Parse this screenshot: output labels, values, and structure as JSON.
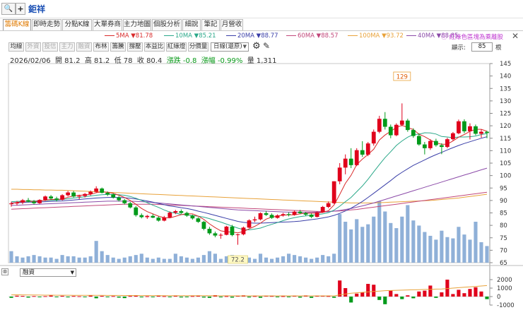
{
  "header": {
    "search_icon": "🔍",
    "add_icon": "+",
    "stock_name": "鉅祥"
  },
  "tabs": [
    {
      "label": "籌碼K線",
      "active": true
    },
    {
      "label": "即時走勢"
    },
    {
      "label": "分點K線"
    },
    {
      "label": "大單券商"
    },
    {
      "label": "主力地圖"
    },
    {
      "label": "個股分析"
    },
    {
      "label": "細說"
    },
    {
      "label": "筆記"
    },
    {
      "label": "月營收"
    }
  ],
  "ma_legend": [
    {
      "label": "5MA ▼81.78",
      "color": "#d92a2a"
    },
    {
      "label": "10MA ▼85.21",
      "color": "#2aa889"
    },
    {
      "label": "20MA ▼88.77",
      "color": "#3a3fa8"
    },
    {
      "label": "60MA ▼88.57",
      "color": "#c2477a"
    },
    {
      "label": "100MA ▼93.72",
      "color": "#e8a23a"
    },
    {
      "label": "40MA ▼88.85",
      "color": "#8b4aa8"
    }
  ],
  "ma_note": "ⓘ 紅綠色區塊為乘離股",
  "toolbar": {
    "buttons": [
      {
        "label": "均線",
        "dim": false
      },
      {
        "label": "外資",
        "dim": true
      },
      {
        "label": "投信",
        "dim": true
      },
      {
        "label": "主力",
        "dim": true
      },
      {
        "label": "融資",
        "dim": true
      },
      {
        "label": "布林",
        "dim": false
      },
      {
        "label": "籌騰",
        "dim": false
      },
      {
        "label": "撐壓",
        "dim": false
      },
      {
        "label": "本益比",
        "dim": false
      },
      {
        "label": "紅綠燈",
        "dim": false
      },
      {
        "label": "分價量",
        "dim": false
      }
    ],
    "period_select": "日線(還原)",
    "zoom_label": "顯示:",
    "zoom_value": "85",
    "zoom_unit": "根"
  },
  "quote": {
    "date": "2026/02/06",
    "open": "開 81.2",
    "high": "高 81.2",
    "low": "低 78",
    "close": "收 80.4",
    "change": "漲跌 -0.8",
    "change_pct": "漲幅 -0.99%",
    "volume": "量 1,311"
  },
  "sub_panel": {
    "close_icon": "⊗",
    "indicator_select": "融資"
  },
  "colors": {
    "up": "#e0001b",
    "down": "#009a1a",
    "volume": "#8fb0d8"
  },
  "chart_data": {
    "type": "candlestick",
    "price_axis": {
      "min": 65,
      "max": 145,
      "ticks": [
        65,
        70,
        75,
        80,
        85,
        90,
        95,
        100,
        105,
        110,
        115,
        120,
        125,
        130,
        135,
        140,
        145
      ]
    },
    "annotations": [
      {
        "label": "129",
        "value": 129
      },
      {
        "label": "72.2",
        "value": 72.2
      }
    ],
    "candles": [
      [
        88.5,
        89.5,
        87.5,
        88.8
      ],
      [
        88.8,
        89.8,
        88.0,
        89.2
      ],
      [
        89.2,
        90.6,
        88.5,
        90.1
      ],
      [
        90.1,
        91.0,
        89.2,
        89.5
      ],
      [
        89.5,
        90.2,
        88.4,
        88.9
      ],
      [
        88.9,
        90.5,
        88.6,
        90.2
      ],
      [
        90.2,
        92.0,
        89.8,
        91.6
      ],
      [
        91.6,
        92.2,
        90.4,
        90.8
      ],
      [
        90.8,
        91.5,
        89.6,
        90.3
      ],
      [
        90.3,
        92.5,
        90.0,
        92.1
      ],
      [
        92.1,
        93.8,
        91.6,
        93.2
      ],
      [
        93.2,
        93.8,
        91.2,
        91.6
      ],
      [
        91.6,
        92.3,
        90.5,
        91.8
      ],
      [
        91.8,
        93.0,
        91.2,
        92.6
      ],
      [
        92.6,
        94.0,
        92.0,
        93.5
      ],
      [
        93.5,
        95.7,
        93.0,
        94.8
      ],
      [
        94.8,
        95.2,
        92.8,
        93.1
      ],
      [
        93.1,
        93.6,
        91.8,
        92.4
      ],
      [
        92.4,
        92.9,
        90.8,
        91.2
      ],
      [
        91.2,
        91.8,
        89.6,
        90.1
      ],
      [
        90.1,
        90.6,
        88.4,
        88.9
      ],
      [
        88.9,
        89.4,
        86.8,
        87.2
      ],
      [
        87.2,
        87.8,
        83.5,
        84.1
      ],
      [
        84.1,
        84.8,
        82.8,
        83.3
      ],
      [
        83.3,
        84.2,
        82.6,
        83.8
      ],
      [
        83.8,
        84.5,
        82.9,
        83.1
      ],
      [
        83.1,
        83.6,
        81.5,
        81.9
      ],
      [
        81.9,
        83.8,
        81.6,
        83.2
      ],
      [
        83.2,
        85.6,
        82.9,
        85.1
      ],
      [
        85.1,
        86.2,
        84.5,
        85.7
      ],
      [
        85.7,
        86.4,
        84.6,
        85.0
      ],
      [
        85.0,
        85.5,
        83.4,
        83.9
      ],
      [
        83.9,
        84.3,
        82.3,
        82.8
      ],
      [
        82.8,
        83.3,
        81.0,
        81.4
      ],
      [
        81.4,
        81.8,
        78.0,
        78.6
      ],
      [
        78.6,
        79.4,
        76.2,
        76.8
      ],
      [
        76.8,
        77.5,
        75.2,
        75.9
      ],
      [
        75.9,
        76.8,
        74.6,
        76.2
      ],
      [
        76.2,
        79.8,
        76.0,
        79.5
      ],
      [
        79.5,
        80.2,
        75.6,
        76.1
      ],
      [
        76.1,
        76.6,
        72.2,
        76.4
      ],
      [
        76.4,
        79.5,
        76.0,
        79.1
      ],
      [
        79.1,
        82.4,
        78.9,
        82.0
      ],
      [
        82.0,
        83.5,
        81.3,
        82.4
      ],
      [
        82.4,
        85.2,
        82.0,
        84.9
      ],
      [
        84.9,
        85.8,
        83.8,
        84.2
      ],
      [
        84.2,
        84.8,
        82.6,
        83.0
      ],
      [
        83.0,
        84.4,
        82.7,
        84.0
      ],
      [
        84.0,
        85.0,
        83.5,
        84.5
      ],
      [
        84.5,
        85.2,
        83.6,
        84.2
      ],
      [
        84.2,
        85.9,
        83.9,
        85.5
      ],
      [
        85.5,
        86.2,
        84.5,
        84.9
      ],
      [
        84.9,
        85.4,
        83.8,
        84.3
      ],
      [
        84.3,
        84.8,
        82.9,
        83.4
      ],
      [
        83.4,
        85.6,
        83.2,
        85.2
      ],
      [
        85.2,
        87.8,
        85.0,
        87.4
      ],
      [
        87.4,
        89.6,
        86.9,
        88.9
      ],
      [
        88.9,
        97.7,
        88.6,
        97.7
      ],
      [
        97.7,
        105.0,
        96.5,
        103.2
      ],
      [
        103.2,
        108.5,
        100.5,
        106.8
      ],
      [
        106.8,
        111.0,
        103.0,
        104.2
      ],
      [
        104.2,
        111.0,
        103.8,
        110.2
      ],
      [
        110.2,
        113.8,
        107.5,
        108.4
      ],
      [
        108.4,
        113.5,
        107.8,
        112.9
      ],
      [
        112.9,
        118.5,
        112.0,
        117.6
      ],
      [
        117.6,
        124.0,
        117.0,
        122.8
      ],
      [
        122.8,
        125.5,
        118.5,
        119.6
      ],
      [
        119.6,
        120.5,
        115.0,
        116.2
      ],
      [
        116.2,
        121.0,
        115.8,
        120.4
      ],
      [
        120.4,
        129.0,
        119.8,
        122.1
      ],
      [
        122.1,
        122.8,
        117.6,
        118.3
      ],
      [
        118.3,
        119.0,
        115.2,
        115.9
      ],
      [
        115.9,
        117.0,
        112.0,
        112.5
      ],
      [
        112.5,
        113.5,
        108.5,
        111.0
      ],
      [
        111.0,
        114.6,
        110.3,
        113.9
      ],
      [
        113.9,
        114.8,
        111.6,
        112.2
      ],
      [
        112.2,
        113.0,
        108.6,
        111.5
      ],
      [
        111.5,
        115.2,
        111.0,
        114.6
      ],
      [
        114.6,
        117.5,
        114.0,
        117.0
      ],
      [
        117.0,
        122.5,
        116.6,
        121.8
      ],
      [
        121.8,
        122.6,
        117.0,
        117.8
      ],
      [
        117.8,
        121.0,
        114.5,
        119.8
      ],
      [
        119.8,
        120.5,
        116.2,
        116.8
      ],
      [
        116.8,
        118.5,
        115.2,
        117.6
      ],
      [
        117.6,
        118.0,
        115.0,
        117.1
      ]
    ],
    "volume": [
      9,
      5,
      4,
      5,
      6,
      5,
      4,
      4,
      3,
      6,
      5,
      5,
      4,
      4,
      5,
      17,
      9,
      6,
      4,
      3,
      4,
      5,
      6,
      7,
      4,
      3,
      4,
      3,
      3,
      7,
      5,
      4,
      3,
      4,
      6,
      9,
      7,
      3,
      5,
      6,
      3,
      5,
      4,
      3,
      7,
      4,
      3,
      4,
      5,
      7,
      6,
      5,
      4,
      3,
      4,
      6,
      5,
      7,
      38,
      32,
      26,
      34,
      28,
      30,
      36,
      48,
      40,
      31,
      27,
      36,
      45,
      33,
      29,
      24,
      21,
      18,
      25,
      20,
      19,
      28,
      22,
      18,
      32,
      16,
      13
    ],
    "ma": {
      "MA5": [
        88.8,
        89.2,
        89.6,
        89.7,
        89.6,
        89.7,
        90.1,
        90.4,
        90.4,
        90.6,
        91.3,
        91.8,
        92.1,
        92.2,
        92.5,
        93.1,
        93.5,
        93.3,
        92.9,
        92.1,
        91.2,
        90.0,
        88.5,
        86.8,
        85.5,
        84.6,
        83.7,
        83.1,
        83.0,
        83.6,
        84.3,
        84.7,
        84.6,
        83.7,
        82.4,
        80.6,
        79.1,
        77.8,
        77.4,
        77.3,
        77.0,
        77.5,
        78.6,
        79.6,
        80.9,
        82.5,
        83.3,
        83.7,
        84.1,
        84.2,
        84.2,
        84.6,
        84.9,
        84.9,
        84.9,
        85.2,
        85.9,
        88.2,
        92.4,
        96.9,
        100.1,
        104.4,
        106.6,
        108.5,
        110.6,
        114.3,
        116.3,
        117.8,
        119.3,
        120.2,
        119.3,
        118.5,
        116.6,
        115.6,
        114.3,
        113.1,
        112.6,
        112.6,
        113.9,
        115.4,
        116.5,
        117.8,
        118.6,
        118.6,
        117.8
      ],
      "MA10": [
        89.5,
        89.6,
        89.7,
        89.8,
        89.8,
        89.9,
        90.0,
        90.1,
        90.2,
        90.4,
        90.7,
        91.0,
        91.2,
        91.5,
        91.8,
        92.1,
        92.3,
        92.4,
        92.4,
        92.3,
        92.1,
        91.6,
        90.9,
        90.0,
        89.1,
        88.1,
        87.2,
        86.2,
        85.3,
        84.9,
        84.4,
        84.2,
        83.9,
        83.7,
        83.3,
        82.7,
        82.0,
        81.3,
        80.5,
        79.7,
        78.9,
        78.3,
        78.2,
        78.5,
        78.9,
        79.7,
        80.4,
        81.1,
        81.9,
        82.6,
        83.1,
        83.5,
        83.8,
        84.1,
        84.3,
        84.6,
        85.1,
        86.1,
        87.7,
        89.5,
        91.2,
        93.5,
        95.8,
        98.5,
        101.5,
        104.4,
        107.2,
        109.6,
        112.1,
        113.9,
        115.4,
        116.5,
        116.6,
        117.2,
        117.1,
        116.7,
        115.7,
        115.5,
        115.2,
        115.5,
        115.5,
        115.6,
        115.9,
        116.5,
        116.9
      ],
      "MA20": [
        89.0,
        89.1,
        89.2,
        89.3,
        89.3,
        89.4,
        89.5,
        89.6,
        89.7,
        89.8,
        90.0,
        90.2,
        90.4,
        90.6,
        90.8,
        91.0,
        91.1,
        91.2,
        91.2,
        91.2,
        91.1,
        90.9,
        90.6,
        90.2,
        89.8,
        89.3,
        88.8,
        88.3,
        87.8,
        87.5,
        87.1,
        86.8,
        86.3,
        85.7,
        85.2,
        84.6,
        84.0,
        83.4,
        82.8,
        82.2,
        81.6,
        81.2,
        81.0,
        80.9,
        80.9,
        81.0,
        81.1,
        81.2,
        81.3,
        81.4,
        81.5,
        81.7,
        82.0,
        82.3,
        82.6,
        83.0,
        83.4,
        84.0,
        84.8,
        85.8,
        86.9,
        88.2,
        89.6,
        91.2,
        92.9,
        94.6,
        96.3,
        98.0,
        99.8,
        101.3,
        102.7,
        104.1,
        105.2,
        106.3,
        107.4,
        108.4,
        109.3,
        110.3,
        111.2,
        112.1,
        112.9,
        113.6,
        114.3,
        115.0,
        115.6
      ],
      "MA40": [
        88.0,
        88.1,
        88.2,
        88.3,
        88.4,
        88.5,
        88.6,
        88.7,
        88.8,
        88.9,
        89.0,
        89.1,
        89.2,
        89.3,
        89.4,
        89.5,
        89.6,
        89.7,
        89.7,
        89.7,
        89.7,
        89.7,
        89.6,
        89.5,
        89.4,
        89.2,
        89.0,
        88.8,
        88.6,
        88.4,
        88.2,
        88.0,
        87.8,
        87.6,
        87.4,
        87.2,
        87.0,
        86.8,
        86.6,
        86.4,
        86.2,
        86.1,
        86.0,
        85.9,
        85.8,
        85.7,
        85.6,
        85.5,
        85.4,
        85.3,
        85.2,
        85.2,
        85.2,
        85.2,
        85.3,
        85.4,
        85.5,
        85.7,
        86.0,
        86.4,
        86.8,
        87.3,
        87.8,
        88.4,
        89.0,
        89.7,
        90.4,
        91.1,
        91.8,
        92.5,
        93.2,
        93.9,
        94.6,
        95.3,
        96.0,
        96.7,
        97.4,
        98.1,
        98.8,
        99.5,
        100.2,
        100.9,
        101.6,
        102.3,
        103.0
      ],
      "MA60": [
        86.5,
        86.6,
        86.7,
        86.8,
        86.9,
        87.0,
        87.1,
        87.2,
        87.3,
        87.4,
        87.5,
        87.6,
        87.7,
        87.8,
        87.9,
        88.0,
        88.1,
        88.2,
        88.3,
        88.4,
        88.5,
        88.5,
        88.5,
        88.5,
        88.5,
        88.5,
        88.4,
        88.3,
        88.2,
        88.1,
        88.0,
        87.9,
        87.8,
        87.7,
        87.6,
        87.5,
        87.4,
        87.3,
        87.2,
        87.1,
        87.0,
        86.9,
        86.8,
        86.7,
        86.6,
        86.5,
        86.4,
        86.3,
        86.2,
        86.1,
        86.0,
        85.9,
        85.8,
        85.7,
        85.6,
        85.6,
        85.6,
        85.7,
        85.8,
        86.0,
        86.2,
        86.4,
        86.7,
        87.0,
        87.3,
        87.6,
        87.9,
        88.2,
        88.5,
        88.8,
        89.1,
        89.4,
        89.7,
        90.0,
        90.3,
        90.6,
        90.9,
        91.2,
        91.5,
        91.8,
        92.1,
        92.4,
        92.7,
        93.0,
        93.3
      ],
      "MA100": [
        94.5,
        94.5,
        94.4,
        94.4,
        94.3,
        94.3,
        94.2,
        94.2,
        94.1,
        94.1,
        94.0,
        93.9,
        93.8,
        93.7,
        93.6,
        93.5,
        93.4,
        93.3,
        93.2,
        93.1,
        93.0,
        92.9,
        92.8,
        92.7,
        92.6,
        92.5,
        92.4,
        92.3,
        92.2,
        92.1,
        92.0,
        91.9,
        91.8,
        91.7,
        91.6,
        91.5,
        91.4,
        91.3,
        91.2,
        91.1,
        91.0,
        90.9,
        90.8,
        90.7,
        90.6,
        90.5,
        90.4,
        90.3,
        90.2,
        90.1,
        90.0,
        89.9,
        89.8,
        89.7,
        89.6,
        89.5,
        89.4,
        89.3,
        89.2,
        89.1,
        89.0,
        89.0,
        89.0,
        89.0,
        89.0,
        89.1,
        89.2,
        89.3,
        89.4,
        89.5,
        89.6,
        89.7,
        89.8,
        89.9,
        90.0,
        90.2,
        90.4,
        90.6,
        90.8,
        91.0,
        91.3,
        91.6,
        91.9,
        92.2,
        92.5
      ]
    },
    "sub_axis": {
      "min": -1000,
      "max": 2000,
      "ticks": [
        2000,
        1000,
        0,
        -1000
      ]
    },
    "margin_balance": [
      -150,
      100,
      80,
      -120,
      60,
      -80,
      50,
      120,
      -60,
      90,
      -90,
      70,
      40,
      -50,
      150,
      -200,
      80,
      -40,
      60,
      -120,
      -180,
      70,
      90,
      -90,
      40,
      -60,
      110,
      50,
      -40,
      120,
      -100,
      -70,
      60,
      130,
      -110,
      -150,
      170,
      -90,
      50,
      -120,
      80,
      150,
      -100,
      60,
      -140,
      90,
      70,
      -80,
      50,
      -60,
      100,
      -120,
      140,
      -150,
      80,
      120,
      60,
      -140,
      1900,
      1000,
      -700,
      350,
      500,
      1500,
      1400,
      -400,
      -900,
      700,
      300,
      -300,
      150,
      -200,
      600,
      700,
      1300,
      -150,
      500,
      2000,
      300,
      800,
      400,
      900,
      1100,
      600,
      -300
    ],
    "margin_ma": [
      200,
      210,
      200,
      190,
      180,
      175,
      170,
      165,
      160,
      158,
      155,
      150,
      148,
      145,
      142,
      140,
      138,
      135,
      132,
      130,
      128,
      125,
      122,
      120,
      118,
      116,
      114,
      112,
      110,
      108,
      106,
      104,
      102,
      100,
      98,
      96,
      94,
      92,
      90,
      88,
      86,
      84,
      82,
      80,
      80,
      80,
      80,
      80,
      80,
      80,
      80,
      80,
      80,
      80,
      80,
      80,
      80,
      80,
      200,
      300,
      400,
      450,
      500,
      550,
      600,
      650,
      700,
      720,
      740,
      760,
      780,
      800,
      820,
      840,
      860,
      880,
      900,
      950,
      1000,
      1050,
      1100,
      1150,
      1200,
      1250,
      1300
    ]
  }
}
